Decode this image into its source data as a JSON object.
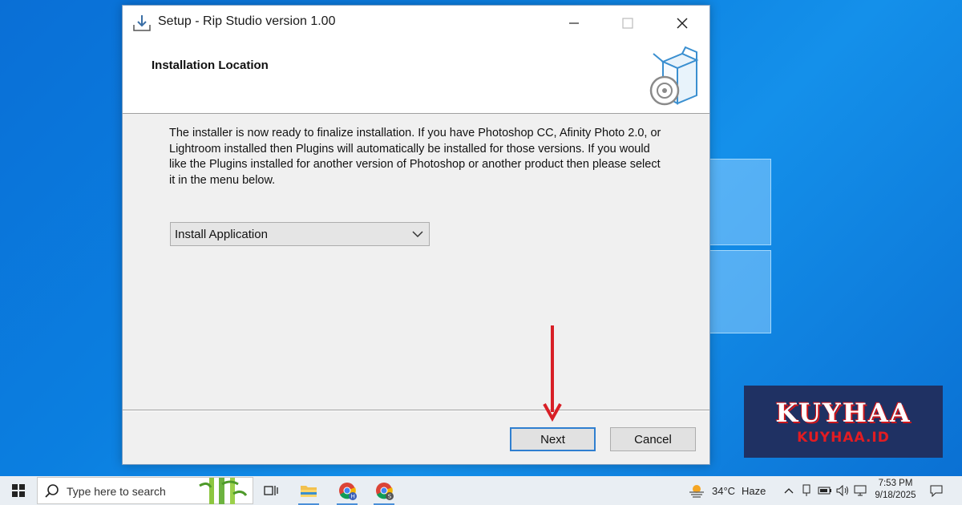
{
  "window": {
    "title": "Setup - Rip Studio version 1.00",
    "header_title": "Installation Location",
    "body_text": "The installer is now ready to finalize installation. If you have Photoshop CC, Afinity Photo 2.0, or Lightroom installed then Plugins will automatically be installed for those versions. If you would like the Plugins installed for another version of Photoshop or another product then please select it in the menu below.",
    "dropdown": {
      "selected": "Install Application"
    },
    "buttons": {
      "next": "Next",
      "cancel": "Cancel"
    },
    "controls": {
      "minimize_icon": "minimize-icon",
      "maximize_icon": "maximize-icon",
      "close_icon": "close-icon"
    }
  },
  "watermark": {
    "big": "KUYHAA",
    "small": "KUYHAA.ID"
  },
  "taskbar": {
    "search_placeholder": "Type here to search",
    "weather": {
      "temp": "34°C",
      "condition": "Haze"
    },
    "clock": {
      "time": "7:53 PM",
      "date": "9/18/2025"
    },
    "apps": [
      "task-view-icon",
      "file-explorer-icon",
      "chrome-profile-h-icon",
      "chrome-profile-s-icon"
    ]
  },
  "colors": {
    "accent": "#2f7fd0",
    "arrow": "#d81f26",
    "watermark_bg": "#1f3163"
  }
}
